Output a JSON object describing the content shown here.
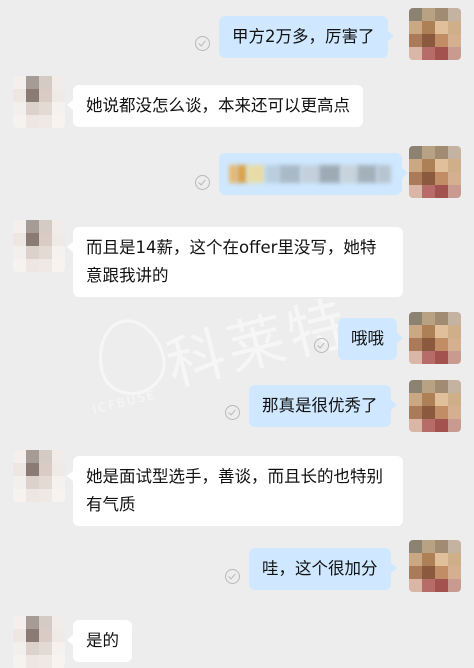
{
  "messages": [
    {
      "side": "out",
      "text": "甲方2万多，厉害了",
      "status": "read"
    },
    {
      "side": "in",
      "text": "她说都没怎么谈，本来还可以更高点"
    },
    {
      "side": "out",
      "text": "",
      "redacted": true,
      "status": "read"
    },
    {
      "side": "in",
      "text": "而且是14薪，这个在offer里没写，她特意跟我讲的"
    },
    {
      "side": "out",
      "text": "哦哦",
      "status": "read"
    },
    {
      "side": "out",
      "text": "那真是很优秀了",
      "status": "read"
    },
    {
      "side": "in",
      "text": "她是面试型选手，善谈，而且长的也特别有气质"
    },
    {
      "side": "out",
      "text": "哇，这个很加分",
      "status": "read"
    },
    {
      "side": "in",
      "text": "是的"
    }
  ],
  "watermark": {
    "text": "科莱特",
    "sub": "ICFBUSE"
  },
  "colors": {
    "background": "#ededed",
    "outgoing_bubble": "#cfe8ff",
    "incoming_bubble": "#ffffff",
    "read_check": "#b8b8b8"
  },
  "icons": {
    "read_receipt": "check-circle-icon",
    "avatar": "pixelated-avatar-image"
  }
}
